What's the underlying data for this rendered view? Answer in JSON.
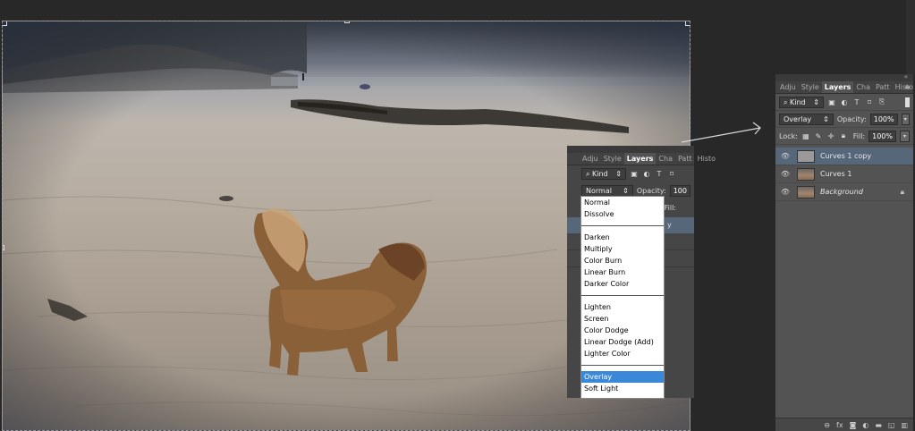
{
  "inset_panel": {
    "tabs": [
      "Adju",
      "Style",
      "Layers",
      "Cha",
      "Patt",
      "Histo"
    ],
    "kind_label": "⌕ Kind",
    "blend_mode": "Normal",
    "opacity_label": "Opacity:",
    "opacity_value": "100",
    "fill_label": "Fill:",
    "partial_text": "y"
  },
  "blend_dropdown": {
    "groups": [
      [
        "Normal",
        "Dissolve"
      ],
      [
        "Darken",
        "Multiply",
        "Color Burn",
        "Linear Burn",
        "Darker Color"
      ],
      [
        "Lighten",
        "Screen",
        "Color Dodge",
        "Linear Dodge (Add)",
        "Lighter Color"
      ],
      [
        "Overlay",
        "Soft Light"
      ]
    ],
    "highlighted": "Overlay"
  },
  "layers_panel": {
    "tabs": [
      "Adju",
      "Style",
      "Layers",
      "Cha",
      "Patt",
      "Histo"
    ],
    "kind_label": "⌕ Kind",
    "blend_mode": "Overlay",
    "opacity_label": "Opacity:",
    "opacity_value": "100%",
    "lock_label": "Lock:",
    "fill_label": "Fill:",
    "fill_value": "100%",
    "layers": [
      {
        "name": "Curves 1 copy",
        "selected": true,
        "italic": false,
        "locked": false
      },
      {
        "name": "Curves 1",
        "selected": false,
        "italic": false,
        "locked": false
      },
      {
        "name": "Background",
        "selected": false,
        "italic": true,
        "locked": true
      }
    ],
    "footer_icons": [
      "link-icon",
      "fx-icon",
      "mask-icon",
      "adjustment-icon",
      "folder-icon",
      "new-layer-icon",
      "trash-icon"
    ]
  },
  "colors": {
    "panel_bg": "#535353",
    "selected_layer": "#56677a",
    "dropdown_highlight": "#3b88d8"
  }
}
